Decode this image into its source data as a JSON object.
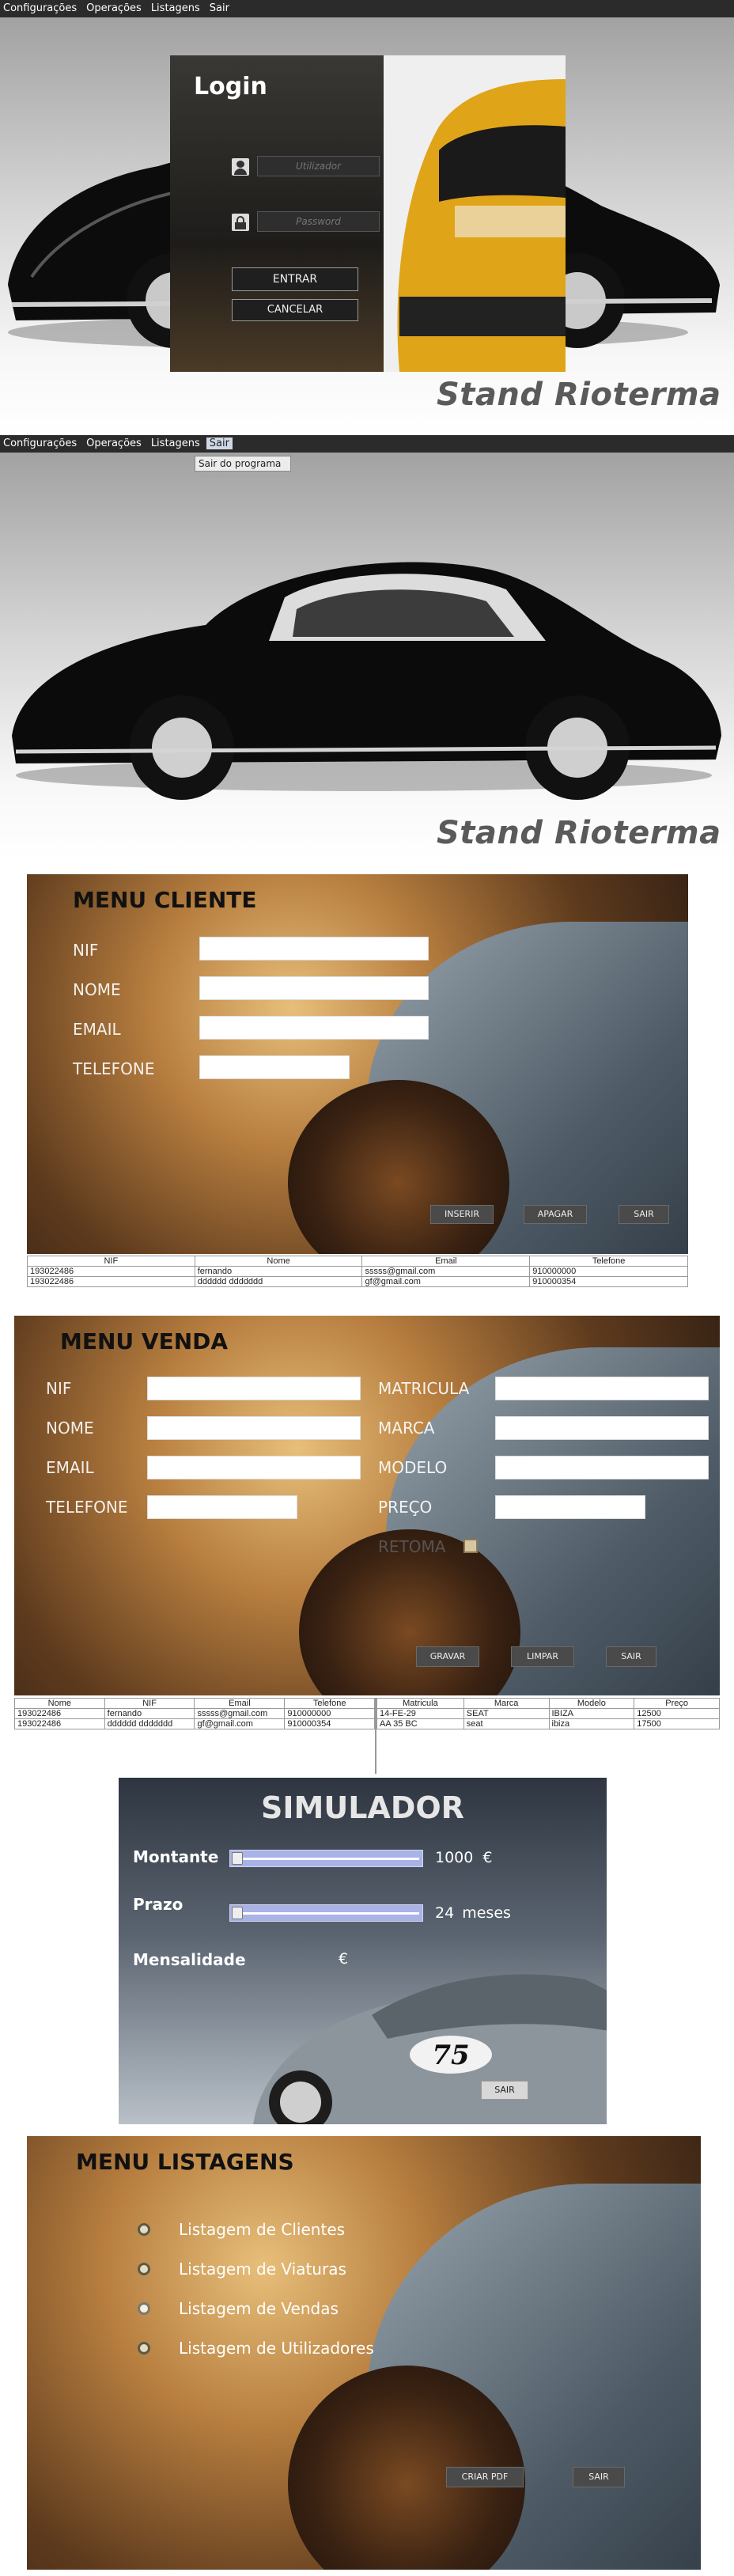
{
  "menus": {
    "configuracoes": "Configurações",
    "operacoes": "Operações",
    "listagens": "Listagens",
    "sair": "Sair",
    "sair_item": "Sair do programa"
  },
  "brand": "Stand Rioterma",
  "login": {
    "title": "Login",
    "user_placeholder": "Utilizador",
    "pass_placeholder": "Password",
    "entrar": "ENTRAR",
    "cancelar": "CANCELAR"
  },
  "cliente": {
    "title": "MENU CLIENTE",
    "nif": "NIF",
    "nome": "NOME",
    "email": "EMAIL",
    "telefone": "TELEFONE",
    "inserir": "INSERIR",
    "apagar": "APAGAR",
    "sair": "SAIR",
    "columns": [
      "NIF",
      "Nome",
      "Email",
      "Telefone"
    ],
    "rows": [
      [
        "193022486",
        "fernando",
        "sssss@gmail.com",
        "910000000"
      ],
      [
        "193022486",
        "dddddd ddddddd",
        "gf@gmail.com",
        "910000354"
      ]
    ]
  },
  "venda": {
    "title": "MENU VENDA",
    "nif": "NIF",
    "nome": "NOME",
    "email": "EMAIL",
    "telefone": "TELEFONE",
    "matricula": "MATRICULA",
    "marca": "MARCA",
    "modelo": "MODELO",
    "preco": "PREÇO",
    "retoma": "RETOMA",
    "gravar": "GRAVAR",
    "limpar": "LIMPAR",
    "sair": "SAIR",
    "left_columns": [
      "Nome",
      "NIF",
      "Email",
      "Telefone"
    ],
    "left_rows": [
      [
        "193022486",
        "fernando",
        "sssss@gmail.com",
        "910000000"
      ],
      [
        "193022486",
        "dddddd ddddddd",
        "gf@gmail.com",
        "910000354"
      ]
    ],
    "right_columns": [
      "Matricula",
      "Marca",
      "Modelo",
      "Preço"
    ],
    "right_rows": [
      [
        "14-FE-29",
        "SEAT",
        "IBIZA",
        "12500"
      ],
      [
        "AA 35 BC",
        "seat",
        "ibiza",
        "17500"
      ]
    ]
  },
  "simulador": {
    "title": "SIMULADOR",
    "montante": "Montante",
    "prazo": "Prazo",
    "mensalidade": "Mensalidade",
    "montante_value": "1000",
    "montante_unit": "€",
    "prazo_value": "24",
    "prazo_unit": "meses",
    "mensalidade_unit": "€",
    "sair": "SAIR",
    "montante_slider": 0,
    "prazo_slider": 0,
    "badge": "75"
  },
  "listagens": {
    "title": "MENU LISTAGENS",
    "options": [
      "Listagem de Clientes",
      "Listagem de Viaturas",
      "Listagem de Vendas",
      "Listagem de Utilizadores"
    ],
    "criar_pdf": "CRIAR PDF",
    "sair": "SAIR"
  }
}
